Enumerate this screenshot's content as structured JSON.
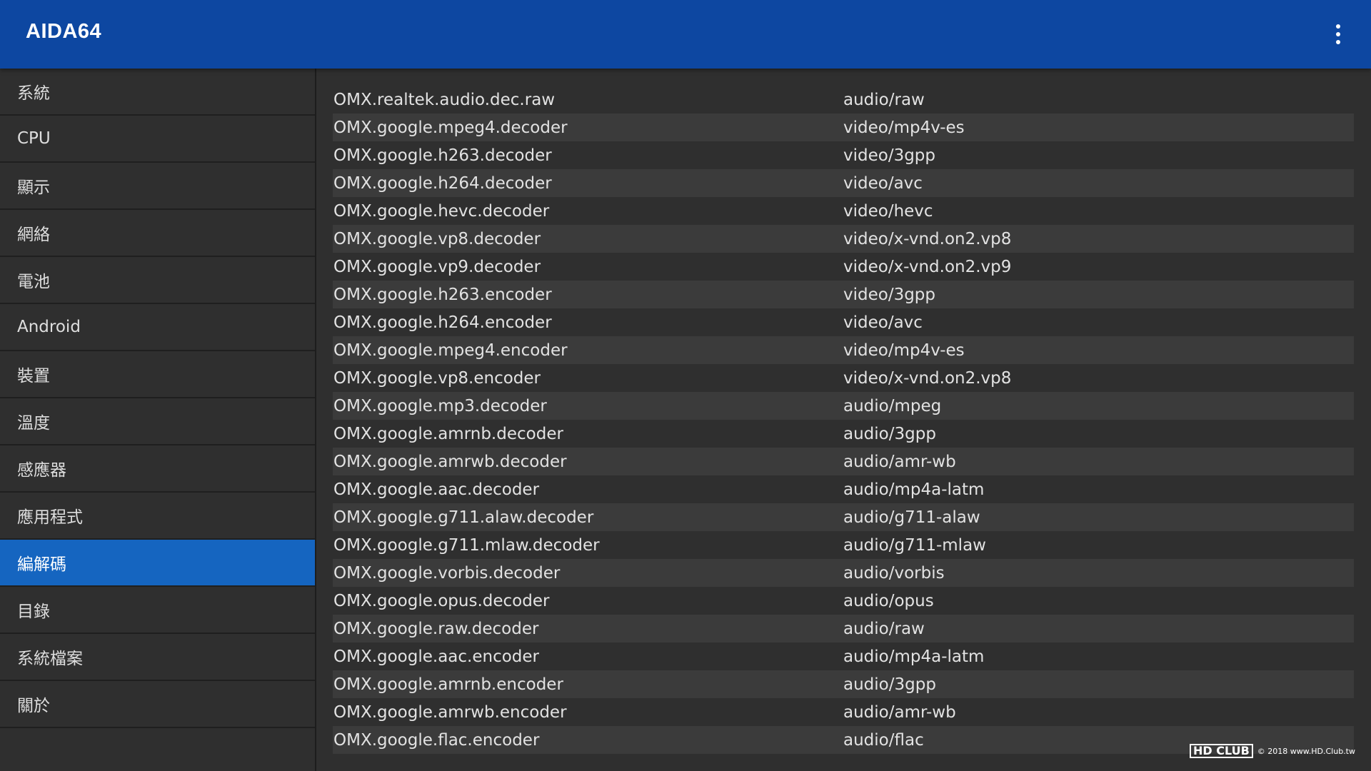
{
  "app": {
    "title": "AIDA64",
    "menu_icon": "more-vert-icon"
  },
  "sidebar": {
    "items": [
      {
        "label": "系統",
        "active": false
      },
      {
        "label": "CPU",
        "active": false
      },
      {
        "label": "顯示",
        "active": false
      },
      {
        "label": "網絡",
        "active": false
      },
      {
        "label": "電池",
        "active": false
      },
      {
        "label": "Android",
        "active": false
      },
      {
        "label": "裝置",
        "active": false
      },
      {
        "label": "溫度",
        "active": false
      },
      {
        "label": "感應器",
        "active": false
      },
      {
        "label": "應用程式",
        "active": false
      },
      {
        "label": "編解碼",
        "active": true
      },
      {
        "label": "目錄",
        "active": false
      },
      {
        "label": "系統檔案",
        "active": false
      },
      {
        "label": "關於",
        "active": false
      }
    ]
  },
  "codecs": [
    {
      "name": "OMX.realtek.audio.dec.raw",
      "type": "audio/raw"
    },
    {
      "name": "OMX.google.mpeg4.decoder",
      "type": "video/mp4v-es"
    },
    {
      "name": "OMX.google.h263.decoder",
      "type": "video/3gpp"
    },
    {
      "name": "OMX.google.h264.decoder",
      "type": "video/avc"
    },
    {
      "name": "OMX.google.hevc.decoder",
      "type": "video/hevc"
    },
    {
      "name": "OMX.google.vp8.decoder",
      "type": "video/x-vnd.on2.vp8"
    },
    {
      "name": "OMX.google.vp9.decoder",
      "type": "video/x-vnd.on2.vp9"
    },
    {
      "name": "OMX.google.h263.encoder",
      "type": "video/3gpp"
    },
    {
      "name": "OMX.google.h264.encoder",
      "type": "video/avc"
    },
    {
      "name": "OMX.google.mpeg4.encoder",
      "type": "video/mp4v-es"
    },
    {
      "name": "OMX.google.vp8.encoder",
      "type": "video/x-vnd.on2.vp8"
    },
    {
      "name": "OMX.google.mp3.decoder",
      "type": "audio/mpeg"
    },
    {
      "name": "OMX.google.amrnb.decoder",
      "type": "audio/3gpp"
    },
    {
      "name": "OMX.google.amrwb.decoder",
      "type": "audio/amr-wb"
    },
    {
      "name": "OMX.google.aac.decoder",
      "type": "audio/mp4a-latm"
    },
    {
      "name": "OMX.google.g711.alaw.decoder",
      "type": "audio/g711-alaw"
    },
    {
      "name": "OMX.google.g711.mlaw.decoder",
      "type": "audio/g711-mlaw"
    },
    {
      "name": "OMX.google.vorbis.decoder",
      "type": "audio/vorbis"
    },
    {
      "name": "OMX.google.opus.decoder",
      "type": "audio/opus"
    },
    {
      "name": "OMX.google.raw.decoder",
      "type": "audio/raw"
    },
    {
      "name": "OMX.google.aac.encoder",
      "type": "audio/mp4a-latm"
    },
    {
      "name": "OMX.google.amrnb.encoder",
      "type": "audio/3gpp"
    },
    {
      "name": "OMX.google.amrwb.encoder",
      "type": "audio/amr-wb"
    },
    {
      "name": "OMX.google.flac.encoder",
      "type": "audio/flac"
    }
  ],
  "watermark": {
    "logo": "HD CLUB",
    "text": "© 2018 www.HD.Club.tw"
  },
  "colors": {
    "appbar": "#0d47a1",
    "active_item": "#1565c0",
    "background": "#2f2f2f",
    "alt_row": "#3b3b3b"
  }
}
